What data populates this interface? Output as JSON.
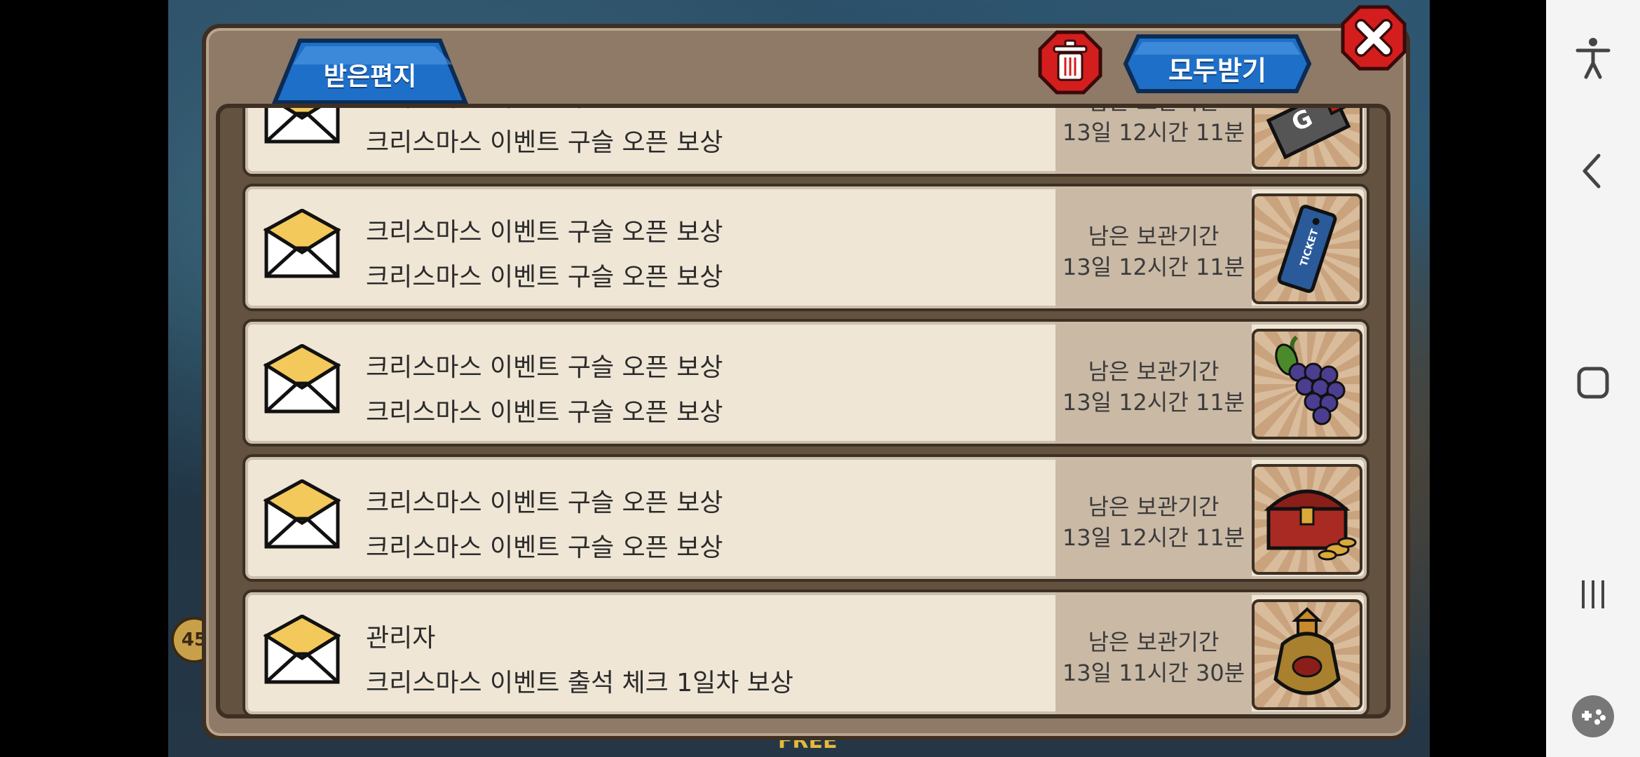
{
  "game_background": {
    "level_badge": "45",
    "free_label": "FREE"
  },
  "mail_window": {
    "tab_label": "받은편지",
    "receive_all_label": "모두받기",
    "icons": {
      "trash": "trash-icon",
      "close": "close-icon",
      "envelope": "envelope-icon"
    },
    "items": [
      {
        "sender": "크리스마스 이벤트 구슬 오픈 보상",
        "message": "크리스마스 이벤트 구슬 오픈 보상",
        "time_label": "남은 보관기간",
        "time_value": "13일 12시간 11분",
        "reward_icon": "gold-ticket-icon"
      },
      {
        "sender": "크리스마스 이벤트 구슬 오픈 보상",
        "message": "크리스마스 이벤트 구슬 오픈 보상",
        "time_label": "남은 보관기간",
        "time_value": "13일 12시간 11분",
        "reward_icon": "ticket-icon",
        "reward_text": "TICKET"
      },
      {
        "sender": "크리스마스 이벤트 구슬 오픈 보상",
        "message": "크리스마스 이벤트 구슬 오픈 보상",
        "time_label": "남은 보관기간",
        "time_value": "13일 12시간 11분",
        "reward_icon": "grapes-icon"
      },
      {
        "sender": "크리스마스 이벤트 구슬 오픈 보상",
        "message": "크리스마스 이벤트 구슬 오픈 보상",
        "time_label": "남은 보관기간",
        "time_value": "13일 12시간 11분",
        "reward_icon": "treasure-chest-icon"
      },
      {
        "sender": "관리자",
        "message": "크리스마스 이벤트 출석 체크 1일차 보상",
        "time_label": "남은 보관기간",
        "time_value": "13일 11시간 30분",
        "reward_icon": "potion-icon"
      }
    ]
  },
  "nav_bar": {
    "buttons": [
      "accessibility-icon",
      "back-icon",
      "home-icon",
      "recents-icon",
      "game-tools-icon"
    ]
  },
  "colors": {
    "panel": "#8e7a66",
    "row": "#efe6d6",
    "tab_blue": "#1e6fc8",
    "trash_red": "#d41e1e"
  }
}
